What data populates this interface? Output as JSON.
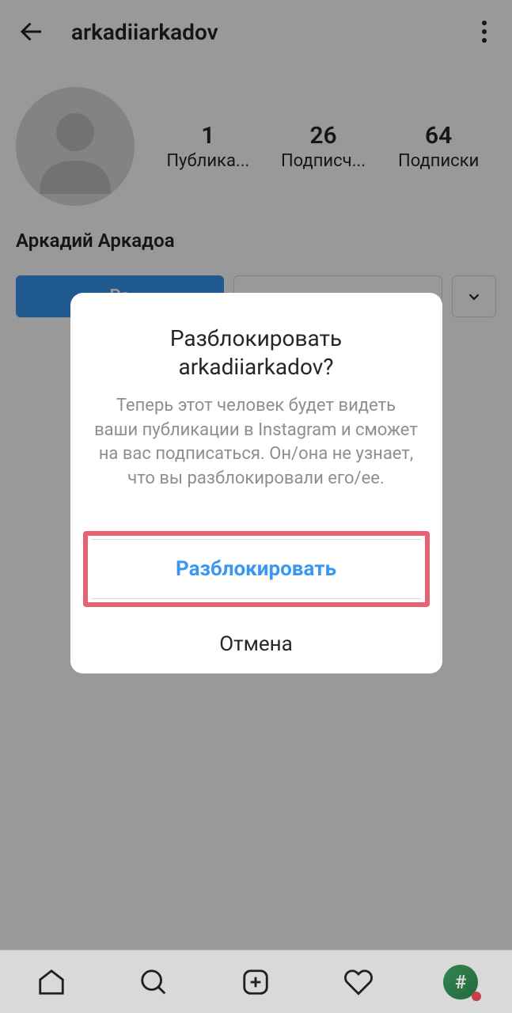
{
  "header": {
    "username": "arkadiiarkadov"
  },
  "profile": {
    "display_name": "Аркадий Аркадоа",
    "stats": {
      "posts": {
        "count": "1",
        "label": "Публика..."
      },
      "followers": {
        "count": "26",
        "label": "Подписч..."
      },
      "following": {
        "count": "64",
        "label": "Подписки"
      }
    }
  },
  "actions": {
    "primary_label": "Ра"
  },
  "dialog": {
    "title": "Разблокировать arkadiiarkadov?",
    "body": "Теперь этот человек будет видеть ваши публикации в Instagram и сможет на вас подписаться. Он/она не узнает, что вы разблокировали его/ее.",
    "confirm_label": "Разблокировать",
    "cancel_label": "Отмена"
  },
  "nav_profile_glyph": "#"
}
